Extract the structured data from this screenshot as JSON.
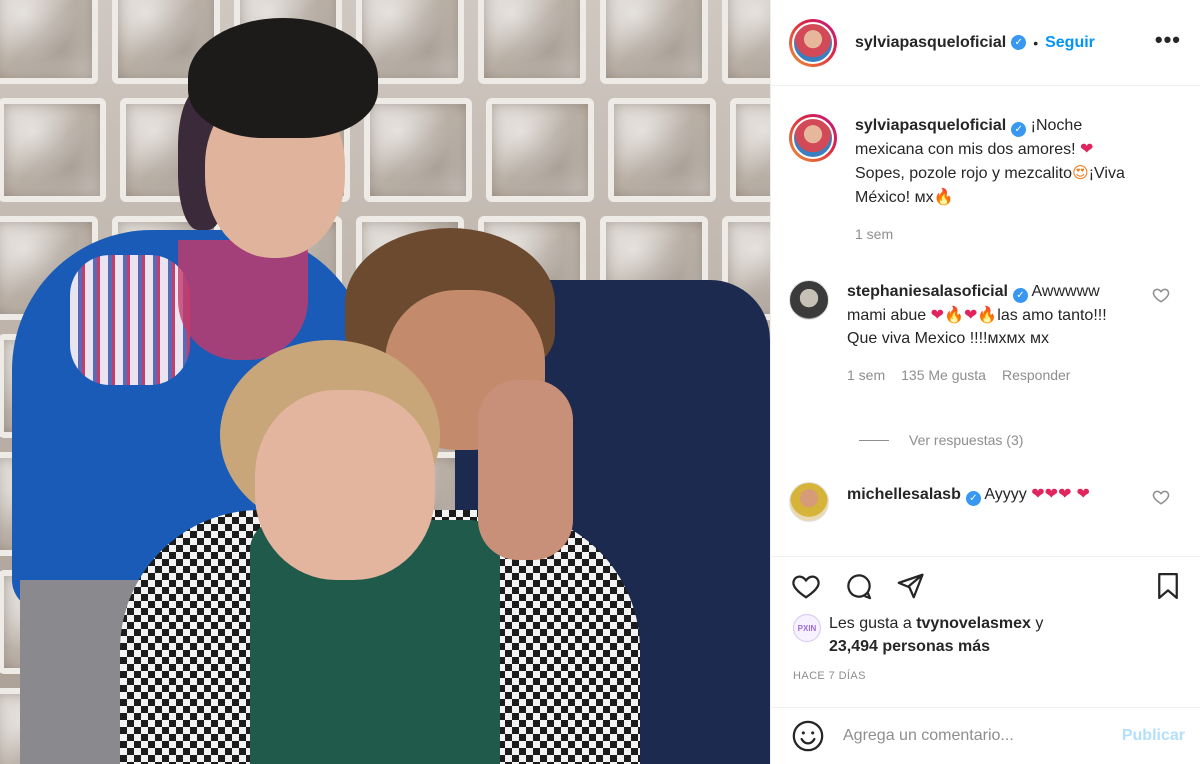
{
  "post": {
    "author": "sylviapasqueloficial",
    "follow_label": "Seguir",
    "more_label": "•••",
    "verified_mark": "✓"
  },
  "caption": {
    "username": "sylviapasqueloficial",
    "text_1": "¡Noche mexicana con mis dos amores!",
    "heart": "❤",
    "text_2": "Sopes, pozole rojo y mezcalito",
    "emoji_star": "😍",
    "text_3": "¡Viva México! ᴍx",
    "emoji_fire": "🔥",
    "time": "1 sem"
  },
  "comments": [
    {
      "username": "stephaniesalasoficial",
      "text_1": "Awwwww mami abue",
      "emoji_line": "❤🔥❤🔥",
      "text_2": "las amo tanto!!! Que viva Mexico !!!!ᴍxᴍx ᴍx",
      "time": "1 sem",
      "likes": "135 Me gusta",
      "reply": "Responder",
      "view_replies": "Ver respuestas (3)"
    },
    {
      "username": "michellesalasb",
      "text_1": "Ayyyy",
      "emoji_line": "❤❤❤ ❤"
    }
  ],
  "likes": {
    "avatar_text": "PXIN",
    "prefix": "Les gusta a",
    "user": "tvynovelasmex",
    "mid": "y",
    "count": "23,494 personas más"
  },
  "posted_ago": "HACE 7 DÍAS",
  "add_comment": {
    "placeholder": "Agrega un comentario...",
    "post_label": "Publicar"
  },
  "colors": {
    "accent": "#0095f6",
    "verified": "#3897f0",
    "muted": "#8e8e8e",
    "heart_red": "#e0245e"
  }
}
